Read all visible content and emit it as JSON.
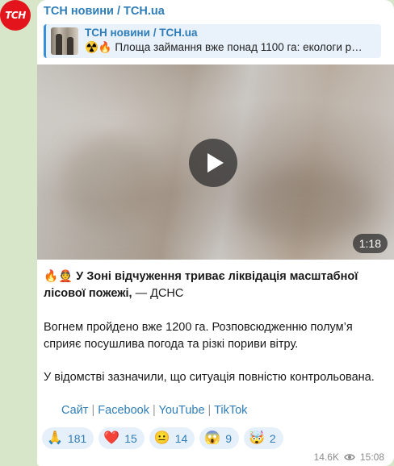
{
  "channel": {
    "avatar_text": "ТСН",
    "name": "ТСН новини / TCH.ua"
  },
  "reply": {
    "title": "ТСН новини / TCH.ua",
    "text": "☢️🔥 Площа займання вже понад 1100 га: екологи р…"
  },
  "video": {
    "duration": "1:18"
  },
  "post": {
    "emoji_prefix": "🔥👲",
    "headline": "У Зоні відчуження триває ліквідація масштабної лісової пожежі,",
    "source": " — ДСНС",
    "p2": "Вогнем пройдено вже 1200 га. Розповсюдженню полум’я сприяє посушлива погода та різкі пориви вітру.",
    "p3": "У відомстві зазначили, що ситуація повністю контрольована."
  },
  "links": {
    "site": "Сайт",
    "facebook": "Facebook",
    "youtube": "YouTube",
    "tiktok": "TikTok",
    "separator": " | "
  },
  "reactions": [
    {
      "emoji": "🙏",
      "count": "181"
    },
    {
      "emoji": "❤️",
      "count": "15"
    },
    {
      "emoji": "😐",
      "count": "14"
    },
    {
      "emoji": "😱",
      "count": "9"
    },
    {
      "emoji": "🤯",
      "count": "2"
    }
  ],
  "meta": {
    "views": "14.6K",
    "time": "15:08"
  },
  "colors": {
    "accent": "#2f7db8",
    "avatar_bg": "#e3141b",
    "chat_bg": "#d7e6c8"
  }
}
